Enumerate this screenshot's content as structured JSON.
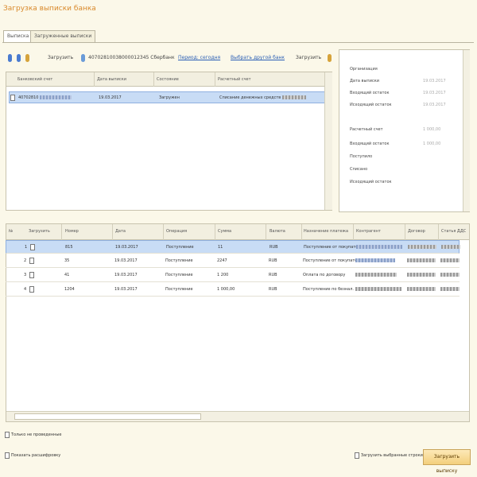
{
  "window": {
    "title": "Загрузка выписки банка"
  },
  "tabs": [
    {
      "label": "Выписка"
    },
    {
      "label": "Загруженные выписки"
    }
  ],
  "toolbar": {
    "left_label": "Загрузить",
    "account_text": "40702810038000012345 Сбербанк",
    "period_link": "Период: сегодня",
    "bank_link": "Выбрать другой банк",
    "right_label": "Загрузить"
  },
  "doc_list": {
    "columns": [
      "Банковский счет",
      "Дата выписки",
      "Состояние",
      "Расчетный счет"
    ],
    "rows": [
      {
        "account": "40702810",
        "date": "19.03.2017",
        "status": "Загружен",
        "settlement": "Списание денежных средств"
      }
    ]
  },
  "info_panel": {
    "labels": [
      "Организация",
      "Дата выписки",
      "Входящий остаток",
      "Исходящий остаток",
      "Расчетный счет",
      "Входящий остаток",
      "Поступило",
      "Списано",
      "Исходящий остаток"
    ],
    "values": [
      "19.03.2017",
      "19.03.2017",
      "19.03.2017",
      "1 000,00",
      "1 000,00"
    ]
  },
  "operations": {
    "columns": [
      "№",
      "Загрузить",
      "Номер",
      "Дата",
      "Операция",
      "Сумма",
      "Валюта",
      "Назначение платежа",
      "Контрагент",
      "Договор",
      "Статья ДДС"
    ],
    "rows": [
      {
        "num": "1",
        "number": "815",
        "date": "19.03.2017",
        "operation": "Поступление",
        "sum": "11",
        "currency": "RUB",
        "purpose": "Поступление от покупателя"
      },
      {
        "num": "2",
        "number": "35",
        "date": "19.03.2017",
        "operation": "Поступление",
        "sum": "2247",
        "currency": "RUB",
        "purpose": "Поступление от покупателя"
      },
      {
        "num": "3",
        "number": "41",
        "date": "19.03.2017",
        "operation": "Поступление",
        "sum": "1 200",
        "currency": "RUB",
        "purpose": "Оплата по договору"
      },
      {
        "num": "4",
        "number": "1204",
        "date": "19.03.2017",
        "operation": "Поступление",
        "sum": "1 000,00",
        "currency": "RUB",
        "purpose": "Поступление по безнал."
      }
    ]
  },
  "footer": {
    "checkbox1": "Только не проведенные",
    "checkbox2": "Показать расшифровку",
    "checkbox3": "Загрузить выбранные строки",
    "button": "Загрузить выписку"
  },
  "colors": {
    "title": "#d9892b",
    "selection": "#c8dcf5",
    "link": "#2b5fb5"
  }
}
